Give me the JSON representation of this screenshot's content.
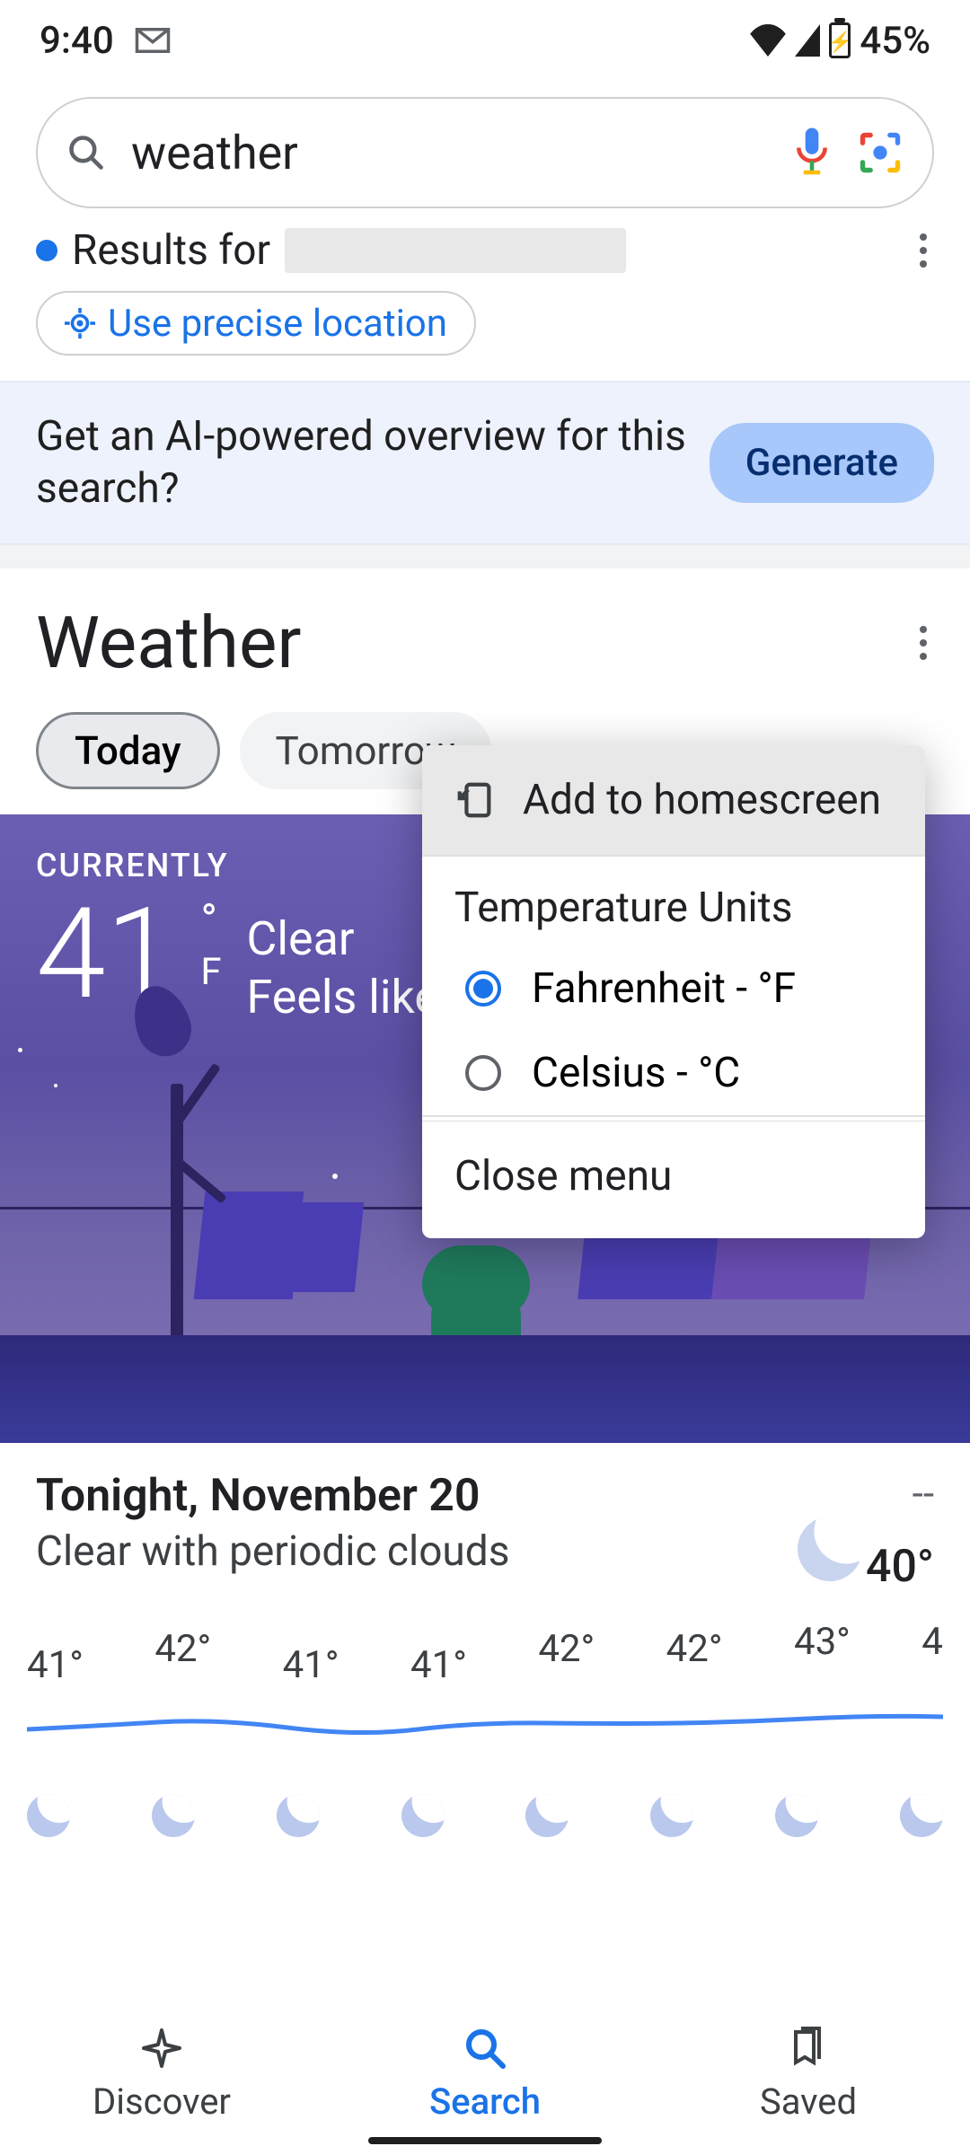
{
  "status": {
    "time": "9:40",
    "battery": "45%"
  },
  "search": {
    "query": "weather"
  },
  "results_for": {
    "prefix": "Results for"
  },
  "location_chip": {
    "label": "Use precise location"
  },
  "ai_banner": {
    "text": "Get an AI-powered overview for this search?",
    "button": "Generate"
  },
  "weather": {
    "title": "Weather",
    "tabs": [
      {
        "label": "Today",
        "active": true
      },
      {
        "label": "Tomorrow",
        "active": false
      }
    ],
    "current": {
      "label": "CURRENTLY",
      "temp": "41",
      "unit_deg": "°",
      "unit_letter": "F",
      "condition": "Clear",
      "feels_like_prefix": "Feels like"
    },
    "tonight": {
      "title": "Tonight, November 20",
      "desc": "Clear with periodic clouds",
      "high": "--",
      "low": "40°"
    },
    "hourly": [
      "41°",
      "42°",
      "41°",
      "41°",
      "42°",
      "42°",
      "43°",
      "4"
    ]
  },
  "popup": {
    "add_home": "Add to homescreen",
    "units_label": "Temperature Units",
    "fahrenheit": "Fahrenheit - °F",
    "celsius": "Celsius - °C",
    "close": "Close menu"
  },
  "bottom_nav": {
    "discover": "Discover",
    "search": "Search",
    "saved": "Saved"
  }
}
